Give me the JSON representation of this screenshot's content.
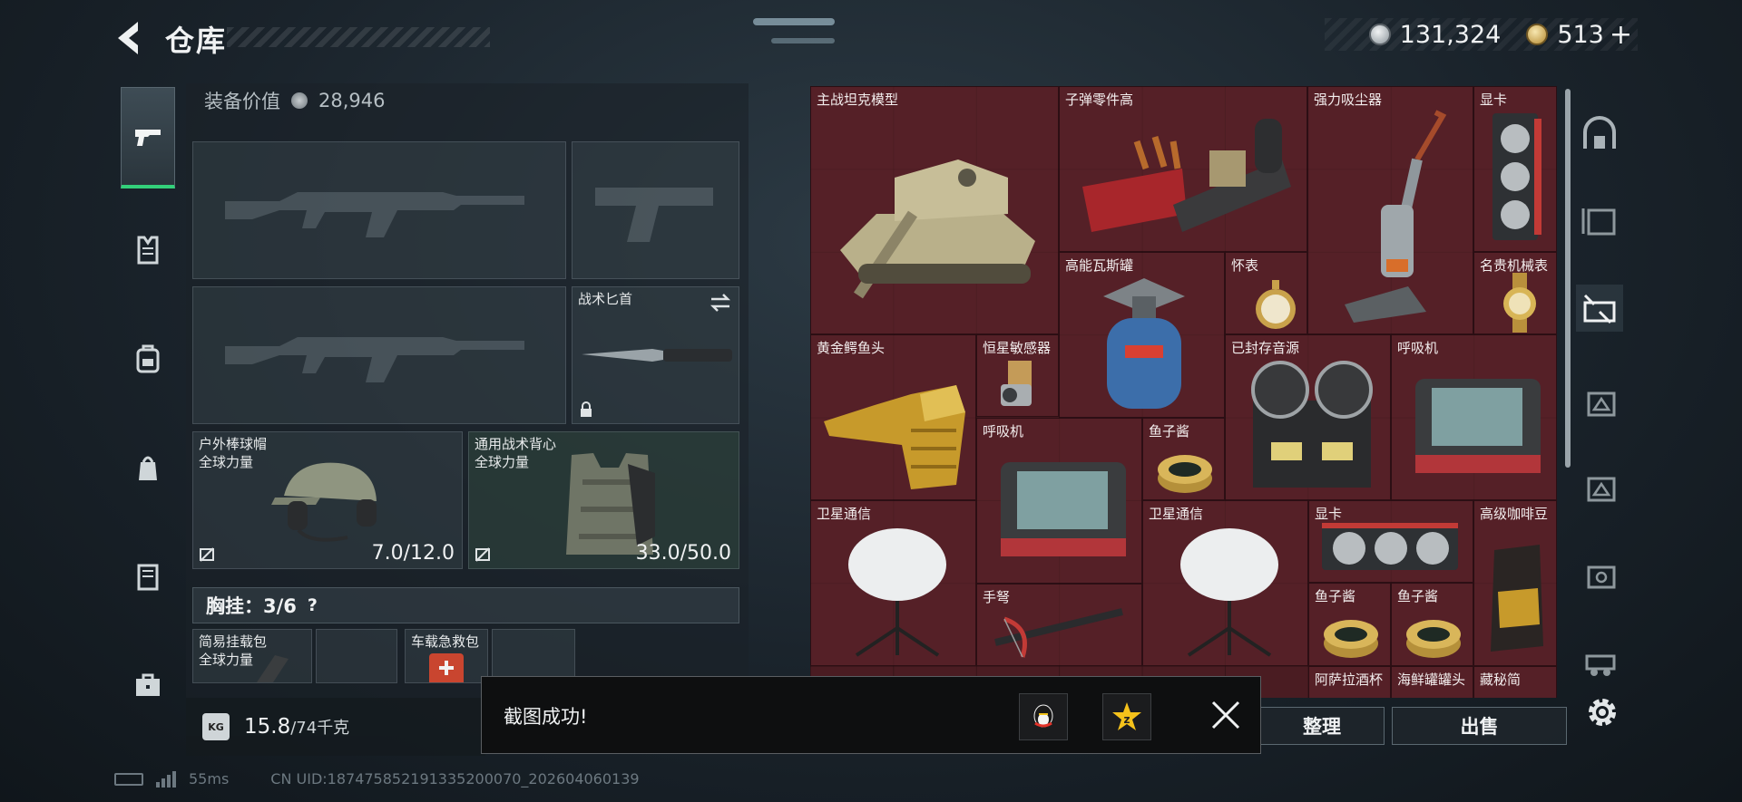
{
  "header": {
    "title": "仓库"
  },
  "currency": {
    "silver": "131,324",
    "gold": "513",
    "plus": "+"
  },
  "loadout": {
    "equip_value_label": "装备价值",
    "equip_value": "28,946",
    "knife": {
      "name": "战术匕首"
    },
    "helmet": {
      "name": "户外棒球帽",
      "faction": "全球力量",
      "durability": "7.0/12.0"
    },
    "armor": {
      "name": "通用战术背心",
      "faction": "全球力量",
      "durability": "33.0/50.0"
    },
    "chest_rig": {
      "label": "胸挂：3/6",
      "help": "?"
    },
    "rig_slots": [
      {
        "name": "简易挂载包",
        "faction": "全球力量"
      },
      {
        "name": "车载急救包"
      }
    ],
    "weight": {
      "current": "15.8",
      "max": "/74千克",
      "icon": "KG"
    }
  },
  "stash": {
    "items": [
      {
        "name": "主战坦克模型"
      },
      {
        "name": "子弹零件高"
      },
      {
        "name": "强力吸尘器"
      },
      {
        "name": "显卡"
      },
      {
        "name": "高能瓦斯罐"
      },
      {
        "name": "怀表"
      },
      {
        "name": "名贵机械表"
      },
      {
        "name": "黄金鳄鱼头"
      },
      {
        "name": "恒星敏感器"
      },
      {
        "name": "已封存音源"
      },
      {
        "name": "呼吸机"
      },
      {
        "name": "呼吸机"
      },
      {
        "name": "鱼子酱"
      },
      {
        "name": "卫星通信"
      },
      {
        "name": "卫星通信"
      },
      {
        "name": "显卡"
      },
      {
        "name": "高级咖啡豆"
      },
      {
        "name": "手弩"
      },
      {
        "name": "鱼子酱"
      },
      {
        "name": "鱼子酱"
      }
    ],
    "partial_labels": [
      "阿萨拉酒杯",
      "海鲜罐罐头",
      "藏秘简"
    ]
  },
  "actions": {
    "sort": "整理",
    "sell": "出售"
  },
  "toast": {
    "message": "截图成功!"
  },
  "status": {
    "ping": "55ms",
    "uid": "CN UID:187475852191335200070_202604060139"
  }
}
